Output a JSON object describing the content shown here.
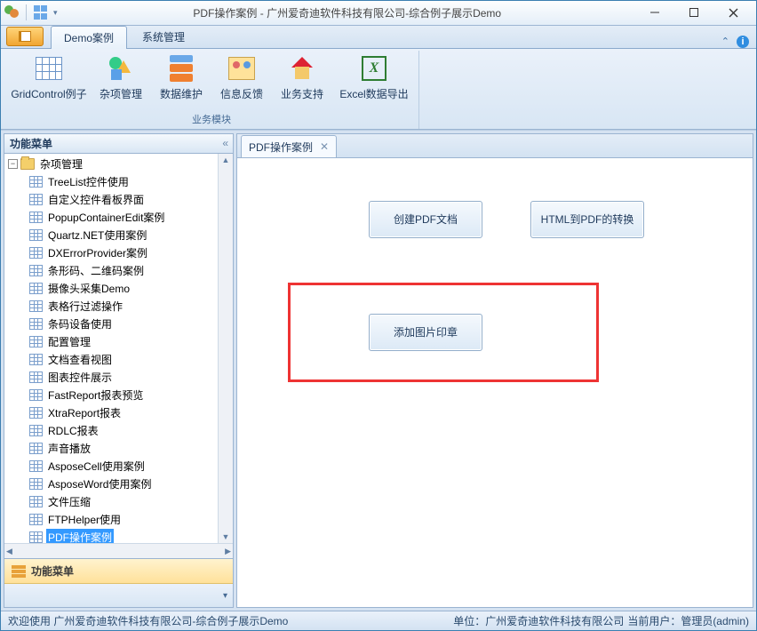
{
  "window": {
    "title": "PDF操作案例 - 广州爱奇迪软件科技有限公司-综合例子展示Demo"
  },
  "ribbon": {
    "tabs": {
      "demo": "Demo案例",
      "sys": "系统管理"
    },
    "group_label": "业务模块",
    "items": {
      "gridcontrol": "GridControl例子",
      "miscmgr": "杂项管理",
      "datamaint": "数据维护",
      "feedback": "信息反馈",
      "bizsupport": "业务支持",
      "excel": "Excel数据导出"
    }
  },
  "sidebar": {
    "title": "功能菜单",
    "root": "杂项管理",
    "items": [
      "TreeList控件使用",
      "自定义控件看板界面",
      "PopupContainerEdit案例",
      "Quartz.NET使用案例",
      "DXErrorProvider案例",
      "条形码、二维码案例",
      "摄像头采集Demo",
      "表格行过滤操作",
      "条码设备使用",
      "配置管理",
      "文档查看视图",
      "图表控件展示",
      "FastReport报表预览",
      "XtraReport报表",
      "RDLC报表",
      "声音播放",
      "AsposeCell使用案例",
      "AsposeWord使用案例",
      "文件压缩",
      "FTPHelper使用",
      "PDF操作案例"
    ],
    "selected_index": 20,
    "bottom_bar": "功能菜单"
  },
  "doc_tab": {
    "label": "PDF操作案例"
  },
  "buttons": {
    "create_pdf": "创建PDF文档",
    "html_to_pdf": "HTML到PDF的转换",
    "add_image_stamp": "添加图片印章"
  },
  "status": {
    "left": "欢迎使用 广州爱奇迪软件科技有限公司-综合例子展示Demo",
    "right_unit": "单位：广州爱奇迪软件科技有限公司",
    "right_user": "当前用户：管理员(admin)"
  }
}
